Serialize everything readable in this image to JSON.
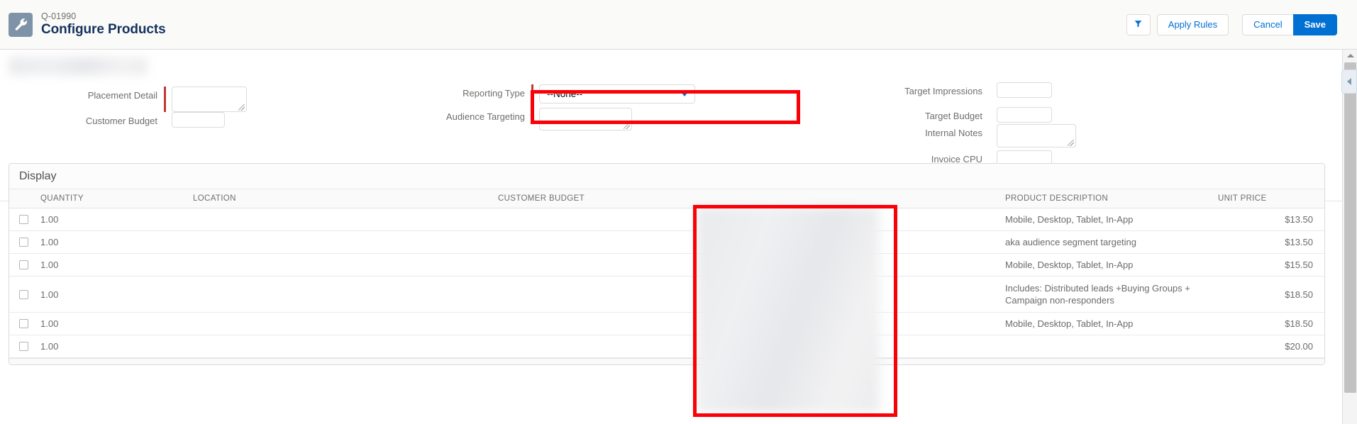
{
  "header": {
    "record_number": "Q-01990",
    "title": "Configure Products",
    "object_icon": "wrench-icon",
    "actions": {
      "filter_label": "",
      "filter_icon": "filter-icon",
      "apply_rules_label": "Apply Rules",
      "cancel_label": "Cancel",
      "save_label": "Save"
    }
  },
  "form": {
    "left_column": [
      {
        "label": "Placement Detail",
        "value": "",
        "type": "textarea",
        "required": true
      },
      {
        "label": "Customer Budget",
        "value": "",
        "type": "text",
        "required": false
      }
    ],
    "middle_column": [
      {
        "label": "Reporting Type",
        "value": "--None--",
        "type": "select",
        "required": true
      },
      {
        "label": "Audience Targeting",
        "value": "",
        "type": "textarea",
        "required": false
      }
    ],
    "right_column": [
      {
        "label": "Target Impressions",
        "value": "",
        "type": "text",
        "required": false
      },
      {
        "label": "Target Budget",
        "value": "",
        "type": "text",
        "required": false
      },
      {
        "label": "Internal Notes",
        "value": "",
        "type": "textarea",
        "required": false
      },
      {
        "label": "Invoice CPU",
        "value": "",
        "type": "text",
        "required": false
      }
    ]
  },
  "table": {
    "section_title": "Display",
    "columns": [
      "QUANTITY",
      "LOCATION",
      "CUSTOMER BUDGET",
      "PRODUCT DESCRIPTION",
      "UNIT PRICE"
    ],
    "rows": [
      {
        "quantity": "1.00",
        "location": "",
        "customer_budget": "",
        "product_description": "Mobile, Desktop, Tablet, In-App",
        "unit_price": "$13.50"
      },
      {
        "quantity": "1.00",
        "location": "",
        "customer_budget": "",
        "product_description": "aka audience segment targeting",
        "unit_price": "$13.50"
      },
      {
        "quantity": "1.00",
        "location": "",
        "customer_budget": "",
        "product_description": "Mobile, Desktop, Tablet, In-App",
        "unit_price": "$15.50"
      },
      {
        "quantity": "1.00",
        "location": "",
        "customer_budget": "",
        "product_description": "Includes: Distributed leads +Buying Groups + Campaign non-responders",
        "unit_price": "$18.50"
      },
      {
        "quantity": "1.00",
        "location": "",
        "customer_budget": "",
        "product_description": "Mobile, Desktop, Tablet, In-App",
        "unit_price": "$18.50"
      },
      {
        "quantity": "1.00",
        "location": "",
        "customer_budget": "",
        "product_description": "",
        "unit_price": "$20.00"
      }
    ]
  },
  "annotations": {
    "highlight_color": "#fb0007",
    "boxes": [
      {
        "name": "reporting-type-highlight"
      },
      {
        "name": "table-column-highlight"
      }
    ]
  },
  "colors": {
    "brand_blue": "#0070d2",
    "required_red": "#c23934",
    "annotation_red": "#fb0007",
    "icon_slate": "#7f93a8"
  }
}
